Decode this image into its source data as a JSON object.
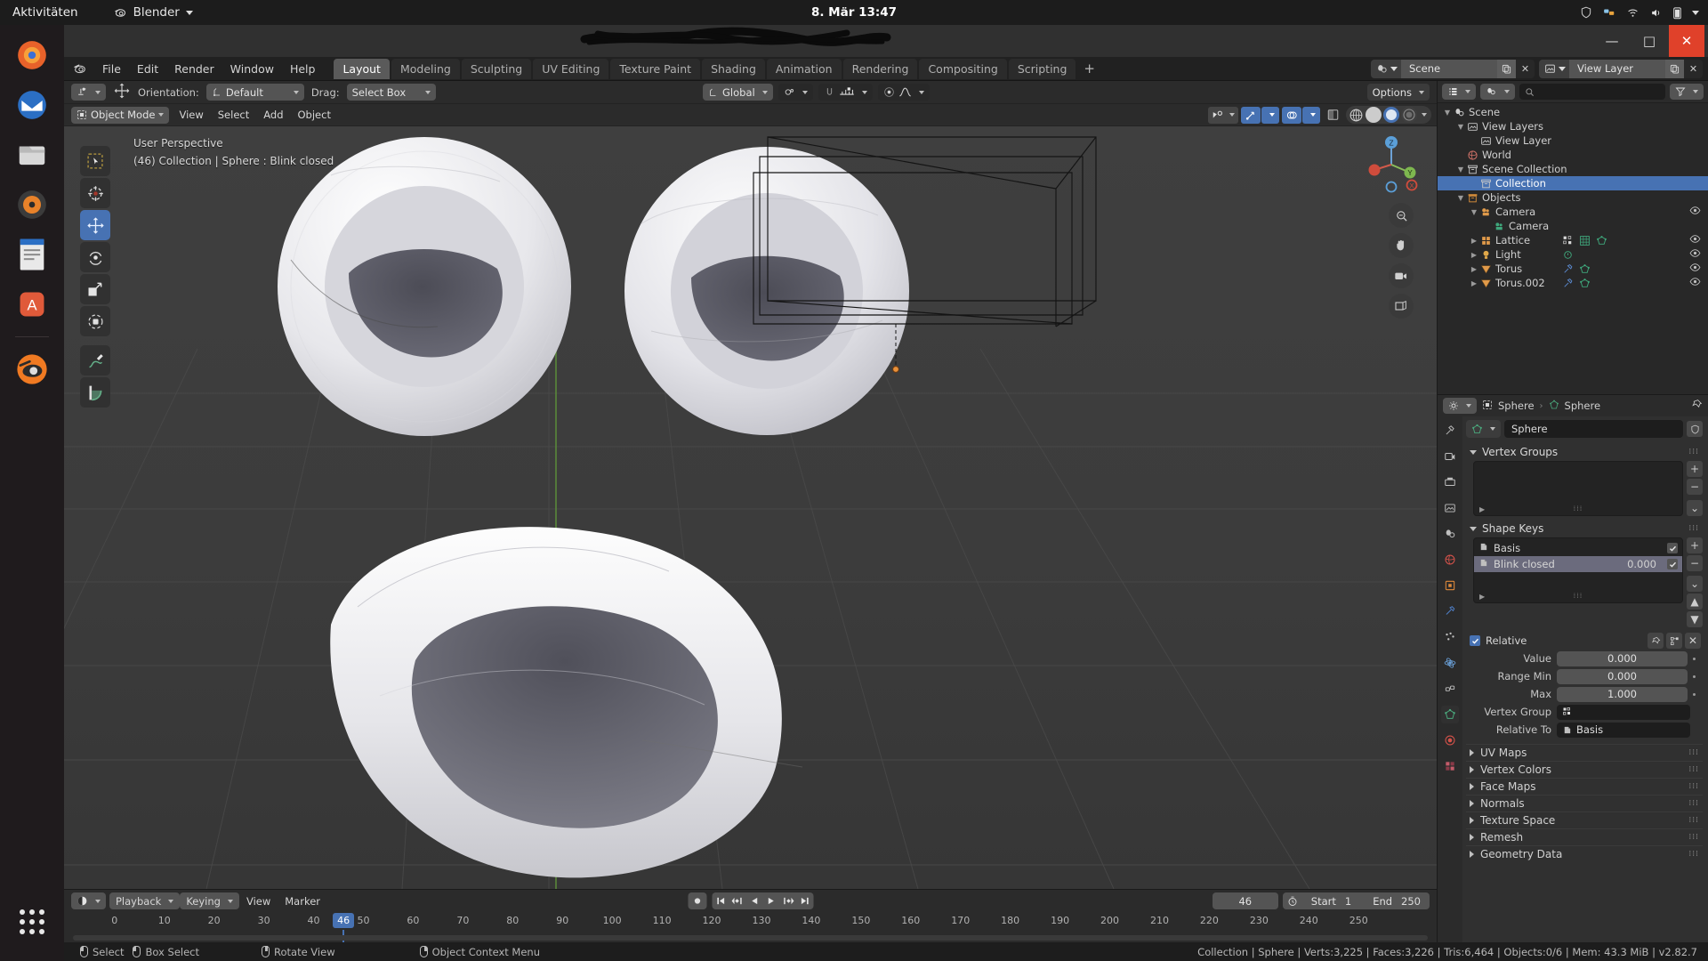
{
  "desktop": {
    "activities": "Aktivitäten",
    "app_name": "Blender",
    "clock": "8. Mär  13:47"
  },
  "window": {
    "minimize": "—",
    "maximize": "□",
    "close": "✕"
  },
  "topbar": {
    "menus": [
      "File",
      "Edit",
      "Render",
      "Window",
      "Help"
    ],
    "workspaces": [
      "Layout",
      "Modeling",
      "Sculpting",
      "UV Editing",
      "Texture Paint",
      "Shading",
      "Animation",
      "Rendering",
      "Compositing",
      "Scripting"
    ],
    "active_workspace": "Layout",
    "add_workspace": "+",
    "scene_name": "Scene",
    "view_layer_name": "View Layer"
  },
  "tool_header": {
    "orientation_label": "Orientation:",
    "orientation_value": "Default",
    "drag_label": "Drag:",
    "drag_value": "Select Box",
    "transform_orientation": "Global",
    "options_label": "Options"
  },
  "mode_header": {
    "mode": "Object Mode",
    "menus": [
      "View",
      "Select",
      "Add",
      "Object"
    ]
  },
  "viewport": {
    "perspective": "User Perspective",
    "info": "(46) Collection | Sphere : Blink closed",
    "gizmo_axes": [
      "X",
      "Y",
      "Z"
    ],
    "tools": [
      "tweak-tool",
      "cursor-tool",
      "move-tool",
      "rotate-tool",
      "scale-tool",
      "transform-tool",
      "annotate-tool",
      "measure-tool"
    ],
    "active_tool": "move-tool"
  },
  "outliner": {
    "search_placeholder": "",
    "rows": [
      {
        "label": "Scene",
        "indent": 0,
        "caret": "down",
        "icon": "scene-icon",
        "selected": false,
        "eye": false
      },
      {
        "label": "View Layers",
        "indent": 1,
        "caret": "down",
        "icon": "viewlayers-icon",
        "selected": false,
        "eye": false
      },
      {
        "label": "View Layer",
        "indent": 2,
        "caret": "none",
        "icon": "viewlayer-icon",
        "selected": false,
        "eye": false
      },
      {
        "label": "World",
        "indent": 1,
        "caret": "none",
        "icon": "world-icon",
        "selected": false,
        "eye": false
      },
      {
        "label": "Scene Collection",
        "indent": 1,
        "caret": "down",
        "icon": "collection-icon",
        "selected": false,
        "eye": false
      },
      {
        "label": "Collection",
        "indent": 2,
        "caret": "none",
        "icon": "collection-icon",
        "selected": true,
        "eye": false
      },
      {
        "label": "Objects",
        "indent": 1,
        "caret": "down",
        "icon": "objects-icon",
        "selected": false,
        "eye": false
      },
      {
        "label": "Camera",
        "indent": 2,
        "caret": "down",
        "icon": "camera-obj-icon",
        "selected": false,
        "eye": true
      },
      {
        "label": "Camera",
        "indent": 3,
        "caret": "none",
        "icon": "camera-data-icon",
        "selected": false,
        "eye": false
      },
      {
        "label": "Lattice",
        "indent": 2,
        "caret": "right",
        "icon": "lattice-icon",
        "selected": false,
        "eye": true,
        "extras": [
          "vertexgroup-icon",
          "lattice-data-icon",
          "mesh-data-icon"
        ]
      },
      {
        "label": "Light",
        "indent": 2,
        "caret": "right",
        "icon": "light-icon",
        "selected": false,
        "eye": true,
        "extras": [
          "light-data-icon"
        ]
      },
      {
        "label": "Torus",
        "indent": 2,
        "caret": "right",
        "icon": "mesh-obj-icon",
        "selected": false,
        "eye": true,
        "extras": [
          "modifier-icon",
          "mesh-data-icon"
        ]
      },
      {
        "label": "Torus.002",
        "indent": 2,
        "caret": "right",
        "icon": "mesh-obj-icon",
        "selected": false,
        "eye": true,
        "extras": [
          "modifier-icon",
          "mesh-data-icon"
        ]
      }
    ]
  },
  "properties": {
    "breadcrumb_object": "Sphere",
    "breadcrumb_data": "Sphere",
    "datablock_name": "Sphere",
    "panels": {
      "vertex_groups": "Vertex Groups",
      "shape_keys": "Shape Keys"
    },
    "shape_keys": [
      {
        "name": "Basis",
        "value": "",
        "checked": true,
        "selected": false
      },
      {
        "name": "Blink closed",
        "value": "0.000",
        "checked": true,
        "selected": true
      }
    ],
    "relative_label": "Relative",
    "relative_checked": true,
    "fields": [
      {
        "label": "Value",
        "value": "0.000",
        "animdot": true
      },
      {
        "label": "Range Min",
        "value": "0.000",
        "animdot": true
      },
      {
        "label": "Max",
        "value": "1.000",
        "animdot": true
      }
    ],
    "vertex_group_label": "Vertex Group",
    "vertex_group_value": "",
    "relative_to_label": "Relative To",
    "relative_to_value": "Basis",
    "closed_panels": [
      "UV Maps",
      "Vertex Colors",
      "Face Maps",
      "Normals",
      "Texture Space",
      "Remesh",
      "Geometry Data"
    ]
  },
  "timeline": {
    "menus": [
      "Playback",
      "Keying",
      "View",
      "Marker"
    ],
    "current_frame": "46",
    "start_label": "Start",
    "start_value": "1",
    "end_label": "End",
    "end_value": "250",
    "ticks": [
      0,
      10,
      20,
      30,
      40,
      50,
      60,
      70,
      80,
      90,
      100,
      110,
      120,
      130,
      140,
      150,
      160,
      170,
      180,
      190,
      200,
      210,
      220,
      230,
      240,
      250
    ],
    "frame_marker": 46
  },
  "statusbar": {
    "hints": [
      {
        "icon": "mouse-left-icon",
        "label": "Select"
      },
      {
        "icon": "mouse-drag-icon",
        "label": "Box Select"
      },
      {
        "icon": "mouse-middle-icon",
        "label": "Rotate View"
      },
      {
        "icon": "mouse-right-icon",
        "label": "Object Context Menu"
      }
    ],
    "stats": "Collection | Sphere | Verts:3,225 | Faces:3,226 | Tris:6,464 | Objects:0/6 | Mem: 43.3 MiB | v2.82.7"
  },
  "colors": {
    "accent": "#4772b3",
    "header": "#2b2b2b",
    "panel": "#303030",
    "outliner": "#282828",
    "close_red": "#e0412a"
  }
}
